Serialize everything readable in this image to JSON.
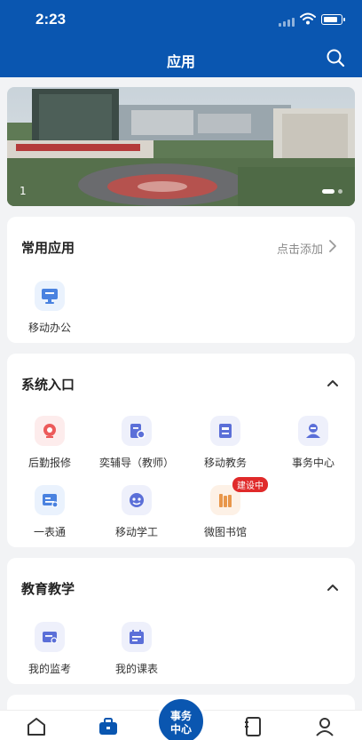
{
  "status_bar": {
    "time": "2:23",
    "battery_level": 0.85
  },
  "header": {
    "title": "应用",
    "search_icon": "search-icon"
  },
  "banner": {
    "index": "1",
    "slides": 2,
    "active_slide": 1
  },
  "frequent": {
    "title": "常用应用",
    "action": "点击添加",
    "apps": [
      {
        "label": "移动办公",
        "icon": "monitor-icon"
      }
    ]
  },
  "system": {
    "title": "系统入口",
    "apps": [
      {
        "label": "后勤报修",
        "icon": "repair-icon"
      },
      {
        "label": "奕辅导（教师）",
        "icon": "tutor-icon"
      },
      {
        "label": "移动教务",
        "icon": "academic-icon"
      },
      {
        "label": "事务中心",
        "icon": "service-icon"
      },
      {
        "label": "一表通",
        "icon": "form-icon"
      },
      {
        "label": "移动学工",
        "icon": "student-affairs-icon"
      },
      {
        "label": "微图书馆",
        "icon": "library-icon",
        "badge": "建设中"
      }
    ]
  },
  "teaching": {
    "title": "教育教学",
    "apps": [
      {
        "label": "我的监考",
        "icon": "invigilation-icon"
      },
      {
        "label": "我的课表",
        "icon": "timetable-icon"
      }
    ]
  },
  "nav": {
    "center_line1": "事务",
    "center_line2": "中心",
    "items": [
      "home-icon",
      "briefcase-icon",
      "notebook-icon",
      "profile-icon"
    ]
  },
  "colors": {
    "primary": "#0a56b0",
    "badge": "#e02a2a",
    "icon_bg": "#eef0fb",
    "icon_fg": "#5b6fd8"
  }
}
